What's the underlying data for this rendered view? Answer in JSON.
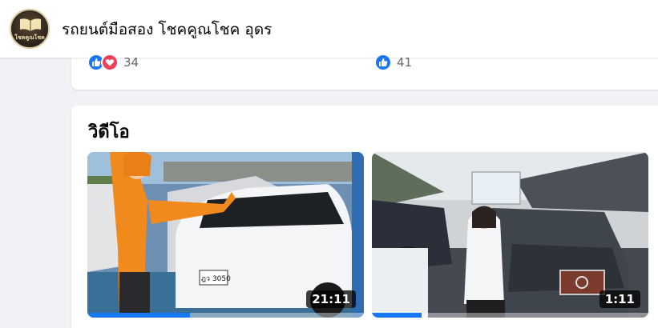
{
  "header": {
    "page_name": "รถยนต์มือสอง โชคคูณโชค อุดร",
    "avatar_label": "โชคคูณโชค"
  },
  "reactions": [
    {
      "icons": [
        "like-icon",
        "love-icon"
      ],
      "count": "34"
    },
    {
      "icons": [
        "like-icon"
      ],
      "count": "41"
    }
  ],
  "videos_section": {
    "title": "วิดีโอ",
    "items": [
      {
        "duration": "21:11",
        "progress": 0.37,
        "plate": "ฎว 3050"
      },
      {
        "duration": "1:11",
        "progress": 0.18
      }
    ]
  },
  "colors": {
    "like": "#1877f2",
    "love": "#f33e58",
    "progress": "#1877f2"
  }
}
